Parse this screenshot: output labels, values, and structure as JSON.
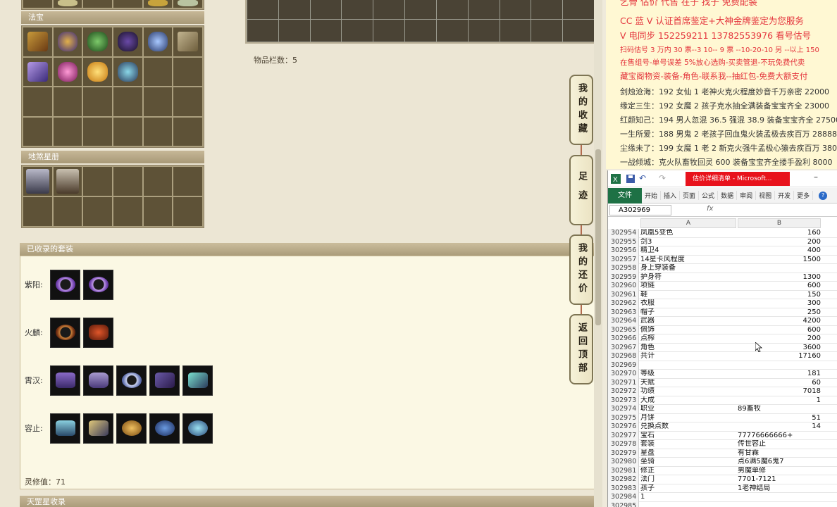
{
  "left": {
    "fabao_header": "法宝",
    "dishahuangce_header": "地煞星册",
    "item_bar_label": "物品栏数：5",
    "suits_header": "已收录的套装",
    "suits": [
      {
        "label": "紫阳:",
        "items": 2
      },
      {
        "label": "火麟:",
        "items": 2
      },
      {
        "label": "霄汉:",
        "items": 5
      },
      {
        "label": "容止:",
        "items": 5
      }
    ],
    "lingxiu_value": "灵修值：71",
    "tiangang_header": "天罡星收录"
  },
  "nav_tabs": [
    {
      "label": "我的收藏"
    },
    {
      "label": "足迹"
    },
    {
      "label": "我的还价"
    },
    {
      "label": "返回顶部"
    }
  ],
  "ad": {
    "top_cut": "乞骨 估价 代售 在子 找子 免费配装",
    "line1": "CC 蓝 V 认证首席鉴定+大神金牌鉴定为您服务",
    "line2": "V 电同步 152259211 13782553976 看号估号",
    "line3": "扫码估号 3 万内 30 票--3 10-- 9 票 --10-20-10 另 --以上 150",
    "line4": "在售组号-单号误差 5%放心选购-买卖管退-不玩免费代卖",
    "line5": "藏宝阁物资-装备-角色-联系我--抽红包-免费大额支付",
    "listings": [
      "剑烛沧海：192 女仙 1 老神火克火程度妙音千万亲密 22000",
      "缘定三生：192 女魔 2 孩子克水抽全满装备宝宝齐全 23000",
      "红颜知己：194 男人忽混 36.5 强混 38.9 装备宝宝齐全 27500",
      "一生所爱：188 男鬼 2 老孩子回血鬼火装孟极去疾百万 28888",
      "尘缘未了：199 女魔 1 老 2 新克火强牛孟极心猿去疾百万 380",
      "一战倾城：克火队畜牧回灵 600 装备宝宝齐全搂手盈利 8000"
    ]
  },
  "excel": {
    "window_title": "估价详细清单 - Microsoft...",
    "file_tab": "文件",
    "tabs": [
      "开始",
      "插入",
      "页面",
      "公式",
      "数据",
      "审阅",
      "视图",
      "开发",
      "更多"
    ],
    "name_box": "A302969",
    "fx": "fx",
    "col_a": "A",
    "col_b": "B",
    "rows": [
      {
        "n": "302954",
        "a": "凤凰5变色",
        "b": "160",
        "num": true
      },
      {
        "n": "302955",
        "a": "剑3",
        "b": "200",
        "num": true
      },
      {
        "n": "302956",
        "a": "精卫4",
        "b": "400",
        "num": true
      },
      {
        "n": "302957",
        "a": "14星卡风程度",
        "b": "1500",
        "num": true
      },
      {
        "n": "302958",
        "a": "身上穿装备",
        "b": "",
        "num": true
      },
      {
        "n": "302959",
        "a": "护身符",
        "b": "1300",
        "num": true
      },
      {
        "n": "302960",
        "a": "项链",
        "b": "600",
        "num": true
      },
      {
        "n": "302961",
        "a": "鞋",
        "b": "150",
        "num": true
      },
      {
        "n": "302962",
        "a": "衣服",
        "b": "300",
        "num": true
      },
      {
        "n": "302963",
        "a": "帽子",
        "b": "250",
        "num": true
      },
      {
        "n": "302964",
        "a": "武器",
        "b": "4200",
        "num": true
      },
      {
        "n": "302965",
        "a": "佩饰",
        "b": "600",
        "num": true
      },
      {
        "n": "302966",
        "a": "点榨",
        "b": "200",
        "num": true
      },
      {
        "n": "302967",
        "a": "角色",
        "b": "3600",
        "num": true
      },
      {
        "n": "302968",
        "a": "共计",
        "b": "17160",
        "num": true
      },
      {
        "n": "302969",
        "a": "",
        "b": "",
        "num": true
      },
      {
        "n": "302970",
        "a": "等级",
        "b": "181",
        "num": true
      },
      {
        "n": "302971",
        "a": "天赋",
        "b": "60",
        "num": true
      },
      {
        "n": "302972",
        "a": "功绩",
        "b": "7018",
        "num": true
      },
      {
        "n": "302973",
        "a": "大成",
        "b": "1",
        "num": true
      },
      {
        "n": "302974",
        "a": "职业",
        "b": "89畜牧",
        "num": false
      },
      {
        "n": "302975",
        "a": "月饼",
        "b": "51",
        "num": true
      },
      {
        "n": "302976",
        "a": "兑换点数",
        "b": "14",
        "num": true
      },
      {
        "n": "302977",
        "a": "宝石",
        "b": "77776666666+",
        "num": false
      },
      {
        "n": "302978",
        "a": "套装",
        "b": "传世容止",
        "num": false
      },
      {
        "n": "302979",
        "a": "星盘",
        "b": "有甘霖",
        "num": false
      },
      {
        "n": "302980",
        "a": "坐骑",
        "b": "点6满5魔6鬼7",
        "num": false
      },
      {
        "n": "302981",
        "a": "修正",
        "b": "男魔单修",
        "num": false
      },
      {
        "n": "302982",
        "a": "法门",
        "b": "7701-7121",
        "num": false
      },
      {
        "n": "302983",
        "a": "孩子",
        "b": "1老神结局",
        "num": false
      },
      {
        "n": "302984",
        "a": "1",
        "b": "",
        "num": false
      },
      {
        "n": "302985",
        "a": "",
        "b": "",
        "num": false
      }
    ]
  }
}
